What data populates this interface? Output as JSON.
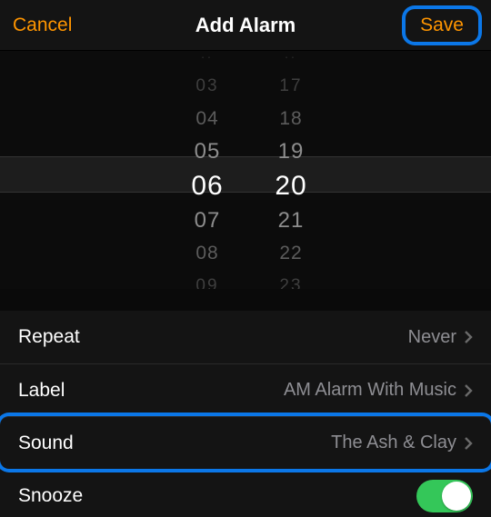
{
  "header": {
    "cancel": "Cancel",
    "title": "Add Alarm",
    "save": "Save"
  },
  "picker": {
    "hours": {
      "m4": "..",
      "m3": "03",
      "m2": "04",
      "m1": "05",
      "sel": "06",
      "p1": "07",
      "p2": "08",
      "p3": "09"
    },
    "mins": {
      "m4": "..",
      "m3": "17",
      "m2": "18",
      "m1": "19",
      "sel": "20",
      "p1": "21",
      "p2": "22",
      "p3": "23"
    }
  },
  "rows": {
    "repeat": {
      "label": "Repeat",
      "value": "Never"
    },
    "label": {
      "label": "Label",
      "value": "AM Alarm With Music"
    },
    "sound": {
      "label": "Sound",
      "value": "The Ash & Clay"
    },
    "snooze": {
      "label": "Snooze",
      "on": true
    }
  }
}
